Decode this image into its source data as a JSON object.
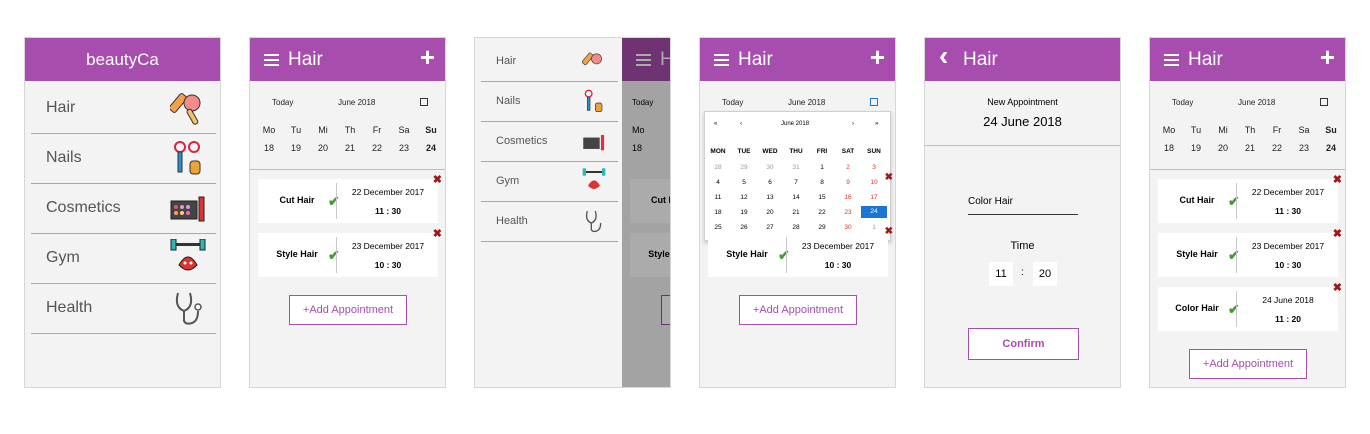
{
  "s1": {
    "title": "beautyCa",
    "items": [
      "Hair",
      "Nails",
      "Cosmetics",
      "Gym",
      "Health"
    ]
  },
  "s2": {
    "title": "Hair",
    "plus": "+",
    "today": "Today",
    "month": "June 2018",
    "weekdays": [
      "Mo",
      "Tu",
      "Mi",
      "Th",
      "Fr",
      "Sa",
      "Su"
    ],
    "days": [
      "18",
      "19",
      "20",
      "21",
      "22",
      "23",
      "24"
    ],
    "appointments": [
      {
        "name": "Cut Hair",
        "date": "22 December 2017",
        "time": "11 : 30"
      },
      {
        "name": "Style Hair",
        "date": "23 December 2017",
        "time": "10 : 30"
      }
    ],
    "add": "+Add Appointment"
  },
  "s3": {
    "items": [
      "Hair",
      "Nails",
      "Cosmetics",
      "Gym",
      "Health"
    ],
    "behind_title": "H",
    "behind_today": "Today",
    "behind_mo": "Mo",
    "behind_18": "18",
    "behind_cut": "Cut H",
    "behind_style": "Style"
  },
  "s4": {
    "title": "Hair",
    "plus": "+",
    "today": "Today",
    "month": "June 2018",
    "picker": {
      "prev2": "«",
      "prev": "‹",
      "month": "June 2018",
      "next": "›",
      "next2": "»",
      "heads": [
        "MON",
        "TUE",
        "WED",
        "THU",
        "FRI",
        "SAT",
        "SUN"
      ],
      "rows": [
        [
          "28",
          "29",
          "30",
          "31",
          "1",
          "2",
          "3"
        ],
        [
          "4",
          "5",
          "6",
          "7",
          "8",
          "9",
          "10"
        ],
        [
          "11",
          "12",
          "13",
          "14",
          "15",
          "16",
          "17"
        ],
        [
          "18",
          "19",
          "20",
          "21",
          "22",
          "23",
          "24"
        ],
        [
          "25",
          "26",
          "27",
          "28",
          "29",
          "30",
          "1"
        ]
      ]
    },
    "card_style": {
      "name": "Style Hair",
      "date": "23 December 2017",
      "time": "10 : 30"
    },
    "add": "+Add Appointment",
    "colors": {
      "weekend": "#e03030",
      "selected": "#1a75d6",
      "muted": "#999999"
    }
  },
  "s5": {
    "back": "‹",
    "title": "Hair",
    "new_appt": "New Appointment",
    "date": "24 June 2018",
    "field": "Color Hair",
    "time_label": "Time",
    "hour": "11",
    "colon": ":",
    "minute": "20",
    "confirm": "Confirm"
  },
  "s6": {
    "title": "Hair",
    "plus": "+",
    "today": "Today",
    "month": "June 2018",
    "weekdays": [
      "Mo",
      "Tu",
      "Mi",
      "Th",
      "Fr",
      "Sa",
      "Su"
    ],
    "days": [
      "18",
      "19",
      "20",
      "21",
      "22",
      "23",
      "24"
    ],
    "appointments": [
      {
        "name": "Cut Hair",
        "date": "22 December 2017",
        "time": "11 : 30"
      },
      {
        "name": "Style Hair",
        "date": "23 December 2017",
        "time": "10 : 30"
      },
      {
        "name": "Color Hair",
        "date": "24 June 2018",
        "time": "11 : 20"
      }
    ],
    "add": "+Add Appointment"
  },
  "icons": {
    "delete": "✖",
    "check": "✔"
  },
  "theme": {
    "accent": "#a64dae",
    "check": "#3aa02a",
    "delete": "#a01818"
  }
}
